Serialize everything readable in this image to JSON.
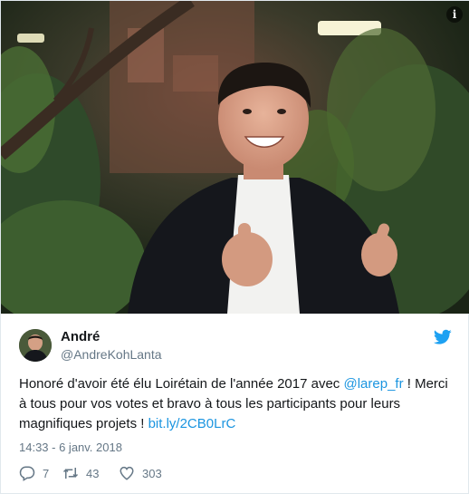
{
  "media": {
    "info_icon": "info-icon",
    "info_symbol": "i"
  },
  "tweet": {
    "author_name": "André",
    "author_handle": "@AndreKohLanta",
    "text_before": "Honoré d'avoir été élu Loirétain de l'année 2017 avec ",
    "mention": "@larep_fr",
    "text_middle": " ! Merci à tous pour vos votes et bravo à tous les participants pour leurs magnifiques projets ! ",
    "link": "bit.ly/2CB0LrC",
    "timestamp": "14:33 - 6 janv. 2018",
    "link_color": "#1b95e0"
  },
  "actions": {
    "replies": "7",
    "retweets": "43",
    "likes": "303"
  },
  "icons": [
    "reply-icon",
    "retweet-icon",
    "heart-icon",
    "twitter-bird-icon",
    "info-icon"
  ]
}
